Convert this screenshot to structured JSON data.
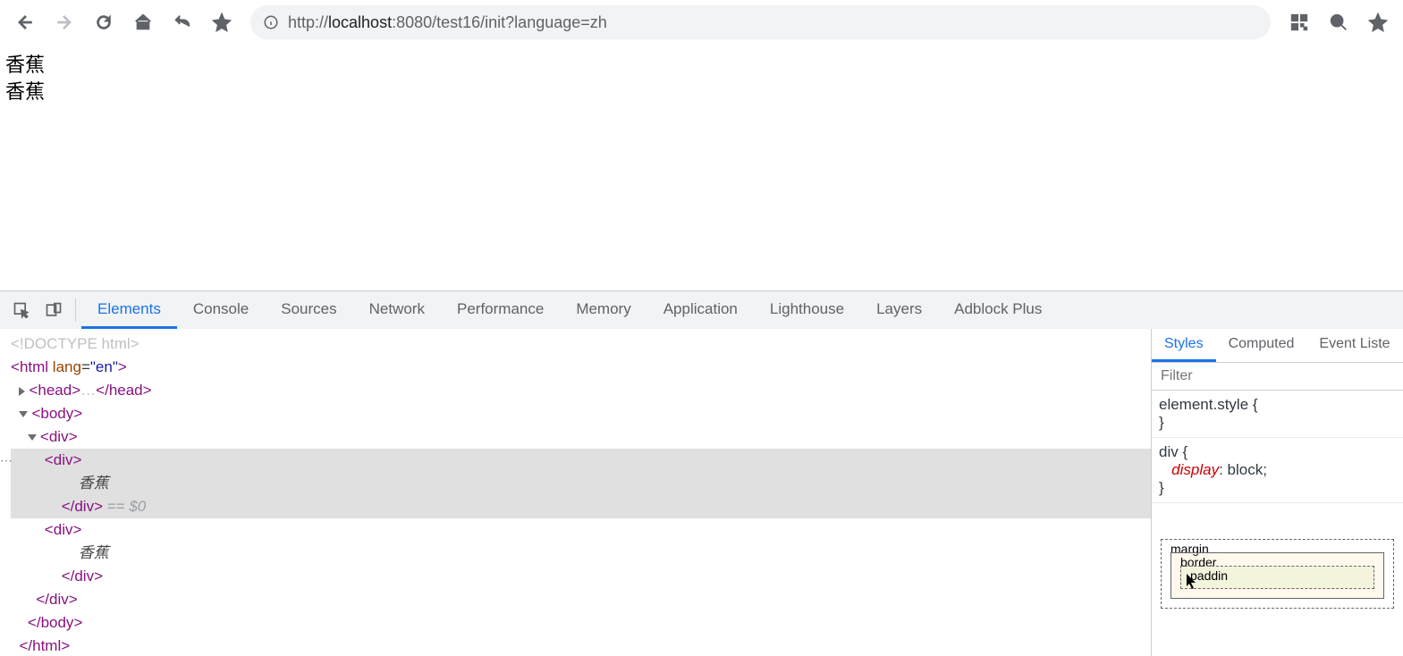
{
  "url": {
    "scheme": "http://",
    "host": "localhost",
    "rest": ":8080/test16/init?language=zh"
  },
  "page_content": [
    "香蕉",
    "香蕉"
  ],
  "devtools_tabs": [
    "Elements",
    "Console",
    "Sources",
    "Network",
    "Performance",
    "Memory",
    "Application",
    "Lighthouse",
    "Layers",
    "Adblock Plus"
  ],
  "devtools_active": "Elements",
  "dom": {
    "doctype": "<!DOCTYPE html>",
    "html_open_tag": "html",
    "html_attr_name": "lang",
    "html_attr_val": "\"en\"",
    "head_tag": "head",
    "head_ellipsis": "…",
    "body_tag": "body",
    "div_tag": "div",
    "inner_text1": "香蕉",
    "inner_text2": "香蕉",
    "eq0": "== $0"
  },
  "styles": {
    "tabs": [
      "Styles",
      "Computed",
      "Event Liste"
    ],
    "filter_placeholder": "Filter",
    "rule1": "element.style {",
    "rule1_close": "}",
    "rule2_selector": "div {",
    "rule2_prop": "display",
    "rule2_val": ": block;",
    "rule2_close": "}",
    "boxmodel": {
      "margin": "margin",
      "border": "border",
      "padding": "paddin"
    }
  }
}
